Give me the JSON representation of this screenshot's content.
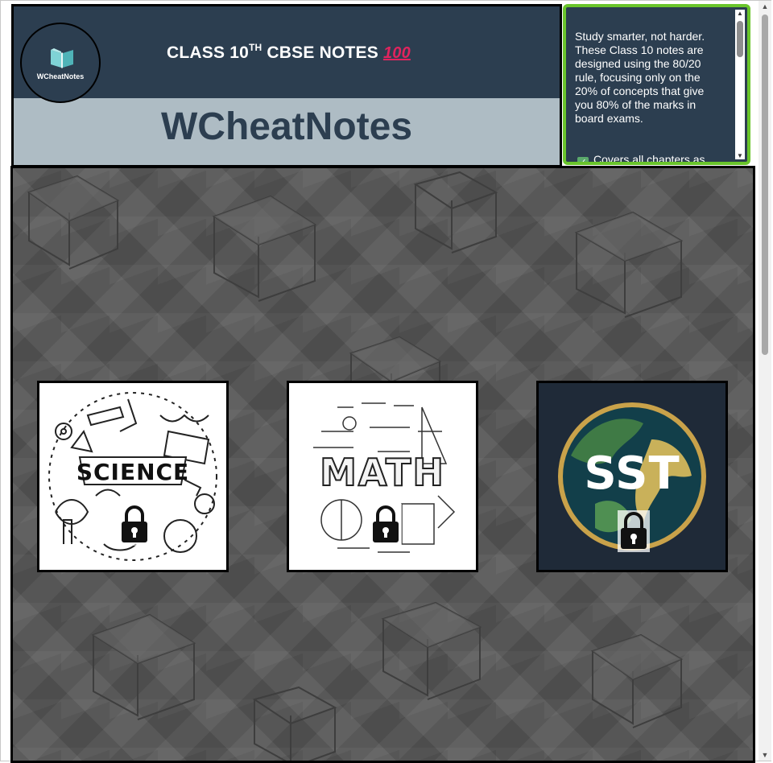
{
  "header": {
    "logo_text": "WCheatNotes",
    "title_prefix": "CLASS 10",
    "title_sup": "TH",
    "title_suffix": "CBSE NOTES",
    "title_emoji": "100",
    "site_name": "WCheatNotes",
    "colors": {
      "dark": "#2c3e50",
      "light": "#aebcc4"
    }
  },
  "info_panel": {
    "description": "Study smarter, not harder. These Class 10 notes are designed using the 80/20 rule, focusing only on the 20% of concepts that give you 80% of the marks in board exams.",
    "checklist_first": "Covers all chapters as",
    "border_color": "#6ac52b"
  },
  "subjects": [
    {
      "label": "SCIENCE",
      "locked": true,
      "icon": "lock-icon"
    },
    {
      "label": "MATH",
      "locked": true,
      "icon": "lock-icon"
    },
    {
      "label": "SST",
      "locked": true,
      "icon": "lock-icon"
    }
  ]
}
